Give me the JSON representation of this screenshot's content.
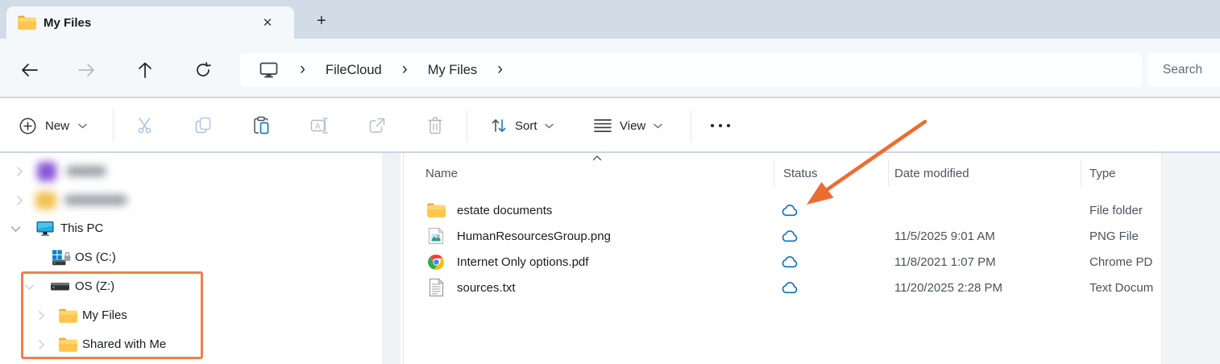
{
  "titlebar": {
    "tab_title": "My Files"
  },
  "navbar": {
    "breadcrumb": {
      "root_icon": "monitor-icon",
      "items": [
        "FileCloud",
        "My Files"
      ]
    },
    "search_label": "Search"
  },
  "toolbar": {
    "new_label": "New",
    "sort_label": "Sort",
    "view_label": "View"
  },
  "sidebar": {
    "items": [
      {
        "label": "This PC",
        "icon": "monitor-icon"
      },
      {
        "label": "OS (C:)",
        "icon": "windows-drive-icon"
      },
      {
        "label": "OS (Z:)",
        "icon": "drive-icon"
      },
      {
        "label": "My Files",
        "icon": "folder-icon"
      },
      {
        "label": "Shared with Me",
        "icon": "folder-icon"
      }
    ]
  },
  "filelist": {
    "columns": [
      "Name",
      "Status",
      "Date modified",
      "Type"
    ],
    "rows": [
      {
        "name": "estate documents",
        "icon": "folder-icon",
        "status_icon": "cloud-icon",
        "date": "",
        "type": "File folder"
      },
      {
        "name": "HumanResourcesGroup.png",
        "icon": "image-file-icon",
        "status_icon": "cloud-icon",
        "date": "11/5/2025 9:01 AM",
        "type": "PNG File"
      },
      {
        "name": "Internet Only options.pdf",
        "icon": "chrome-file-icon",
        "status_icon": "cloud-icon",
        "date": "11/8/2021 1:07 PM",
        "type": "Chrome PD"
      },
      {
        "name": "sources.txt",
        "icon": "text-file-icon",
        "status_icon": "cloud-icon",
        "date": "11/20/2025 2:28 PM",
        "type": "Text Docum"
      }
    ]
  },
  "annotations": {
    "highlight_color": "#f08049",
    "arrow_color": "#ed6c32"
  },
  "colors": {
    "accent_blue": "#0f6cbd",
    "cloud_blue": "#0c6cc4",
    "titlebar_bg": "#d2dce7",
    "folder_yellow": "#fcc64e"
  }
}
